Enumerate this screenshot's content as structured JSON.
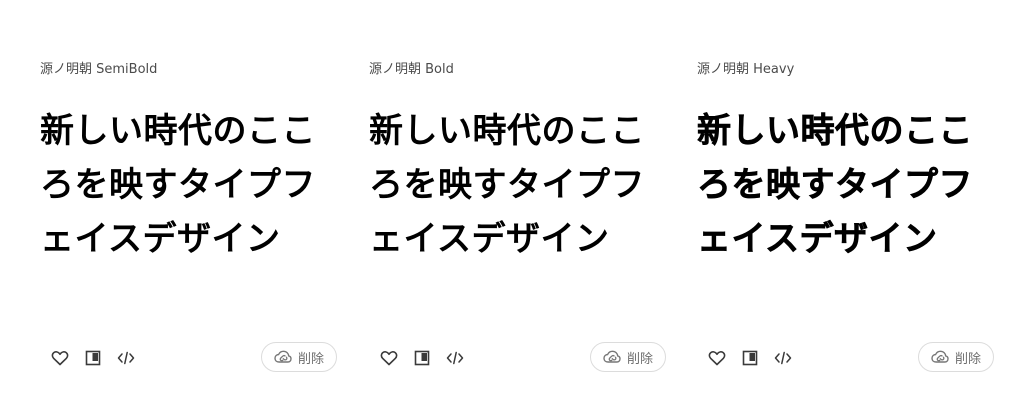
{
  "cards": [
    {
      "font_name": "源ノ明朝 SemiBold",
      "sample_text": "新しい時代のこころを映すタイプフェイスデザイン",
      "remove_label": "削除",
      "icons": [
        "heart-icon",
        "specimen-icon",
        "embed-code-icon",
        "creative-cloud-icon"
      ]
    },
    {
      "font_name": "源ノ明朝 Bold",
      "sample_text": "新しい時代のこころを映すタイプフェイスデザイン",
      "remove_label": "削除",
      "icons": [
        "heart-icon",
        "specimen-icon",
        "embed-code-icon",
        "creative-cloud-icon"
      ]
    },
    {
      "font_name": "源ノ明朝 Heavy",
      "sample_text": "新しい時代のこころを映すタイプフェイスデザイン",
      "remove_label": "削除",
      "icons": [
        "heart-icon",
        "specimen-icon",
        "embed-code-icon",
        "creative-cloud-icon"
      ]
    }
  ],
  "colors": {
    "text_primary": "#000000",
    "text_secondary": "#4b4b4b",
    "icon": "#3a3a3a",
    "button_border": "#dcdcdc",
    "button_text": "#6e6e6e"
  }
}
